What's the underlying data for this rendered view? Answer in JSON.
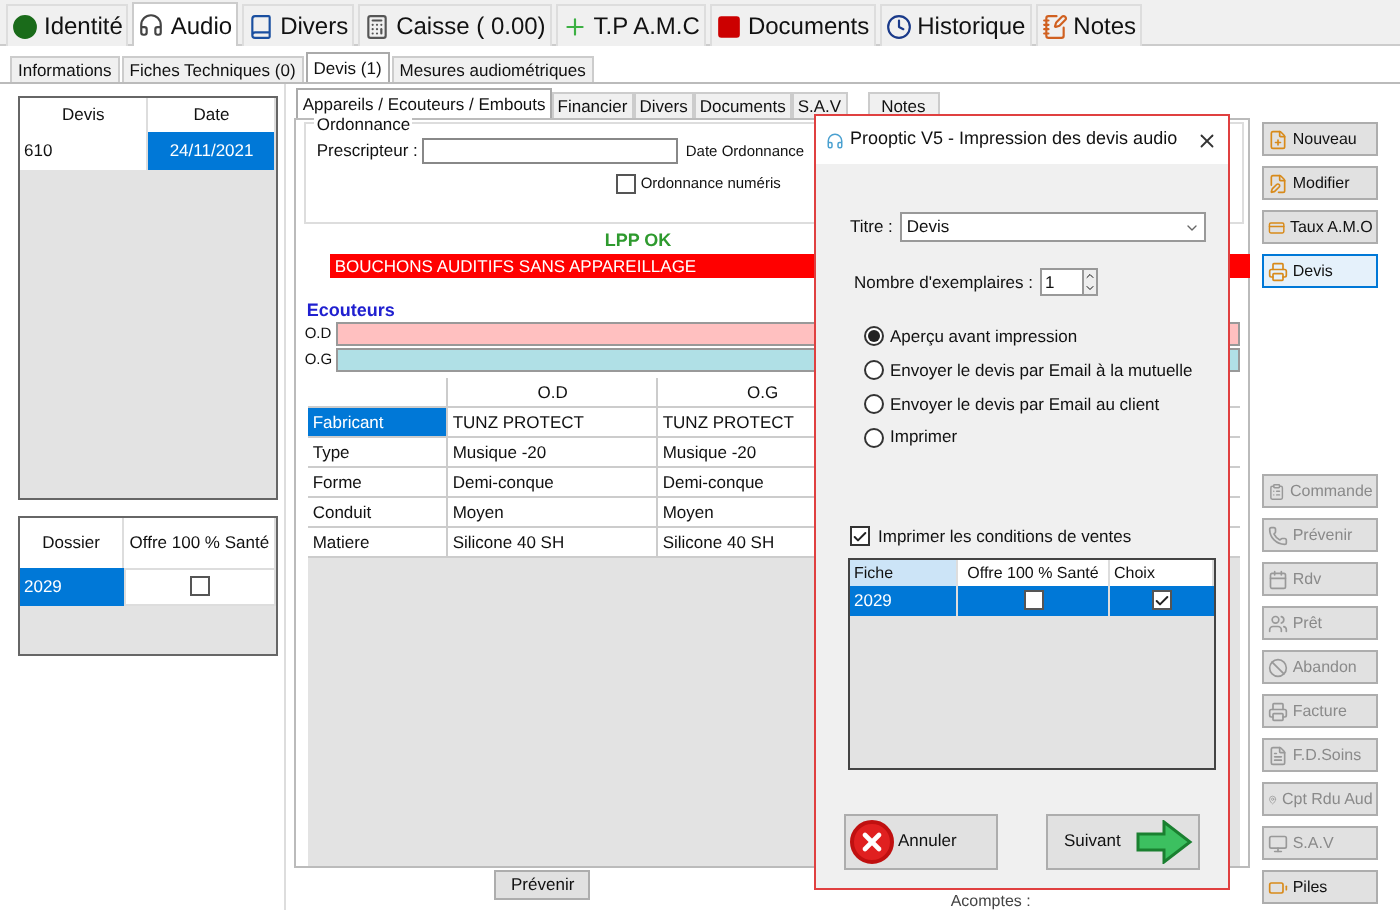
{
  "main_tabs": [
    {
      "label": "Identité",
      "selected": false
    },
    {
      "label": "Audio",
      "selected": true
    },
    {
      "label": "Divers",
      "selected": false
    },
    {
      "label": "Caisse ( 0.00)",
      "selected": false
    },
    {
      "label": "T.P A.M.C",
      "selected": false
    },
    {
      "label": "Documents",
      "selected": false
    },
    {
      "label": "Historique",
      "selected": false
    },
    {
      "label": "Notes",
      "selected": false
    }
  ],
  "sub_tabs": [
    {
      "label": "Informations",
      "selected": false
    },
    {
      "label": "Fiches Techniques (0)",
      "selected": false
    },
    {
      "label": "Devis (1)",
      "selected": true
    },
    {
      "label": "Mesures audiométriques",
      "selected": false
    }
  ],
  "devis_table": {
    "columns": [
      "Devis",
      "Date"
    ],
    "rows": [
      {
        "cells": [
          {
            "text": "610",
            "selected": false
          },
          {
            "text": "24/11/2021",
            "selected": true
          }
        ]
      }
    ]
  },
  "dossier_table": {
    "columns": [
      "Dossier",
      "Offre 100 % Santé"
    ],
    "rows": [
      {
        "dossier": "2029",
        "selected": true,
        "offre_checked": false
      }
    ]
  },
  "detail_tabs": [
    {
      "label": "Appareils / Ecouteurs / Embouts",
      "selected": true
    },
    {
      "label": "Financier",
      "selected": false
    },
    {
      "label": "Divers",
      "selected": false
    },
    {
      "label": "Documents",
      "selected": false
    },
    {
      "label": "S.A.V",
      "selected": false
    },
    {
      "label": "Notes",
      "selected": false
    }
  ],
  "ordonnance": {
    "title": "Ordonnance",
    "prescripteur_label": "Prescripteur :",
    "date_label": "Date Ordonnance",
    "numerique_label": "Ordonnance numéris",
    "numerique_checked": false
  },
  "lpp_status": "LPP OK",
  "alert": "BOUCHONS AUDITIFS SANS APPAREILLAGE",
  "ecouteurs": {
    "title": "Ecouteurs",
    "bars": [
      {
        "label": "O.D",
        "color": "#ffc0c0"
      },
      {
        "label": "O.G",
        "color": "#b0e0e6"
      }
    ]
  },
  "grid": {
    "columns": [
      "O.D",
      "O.G"
    ],
    "rows": [
      {
        "label": "Fabricant",
        "selected": true,
        "values": [
          "TUNZ PROTECT",
          "TUNZ PROTECT"
        ]
      },
      {
        "label": "Type",
        "selected": false,
        "values": [
          "Musique -20",
          "Musique -20"
        ]
      },
      {
        "label": "Forme",
        "selected": false,
        "values": [
          "Demi-conque",
          "Demi-conque"
        ]
      },
      {
        "label": "Conduit",
        "selected": false,
        "values": [
          "Moyen",
          "Moyen"
        ]
      },
      {
        "label": "Matiere",
        "selected": false,
        "values": [
          "Silicone 40 SH",
          "Silicone 40 SH"
        ]
      }
    ]
  },
  "prevenir_button": "Prévenir",
  "acomptes_label": "Acomptes :",
  "side_buttons": [
    {
      "label": "Nouveau",
      "kind": "new",
      "disabled": false,
      "selected": false
    },
    {
      "label": "Modifier",
      "kind": "edit",
      "disabled": false,
      "selected": false
    },
    {
      "label": "Taux A.M.O",
      "kind": "card",
      "disabled": false,
      "selected": false
    },
    {
      "label": "Devis",
      "kind": "print",
      "disabled": false,
      "selected": true
    },
    {
      "label": "Commande",
      "kind": "order",
      "disabled": true,
      "selected": false
    },
    {
      "label": "Prévenir",
      "kind": "phone",
      "disabled": true,
      "selected": false
    },
    {
      "label": "Rdv",
      "kind": "calendar",
      "disabled": true,
      "selected": false
    },
    {
      "label": "Prêt",
      "kind": "lend",
      "disabled": true,
      "selected": false
    },
    {
      "label": "Abandon",
      "kind": "cancel",
      "disabled": true,
      "selected": false
    },
    {
      "label": "Facture",
      "kind": "print",
      "disabled": true,
      "selected": false
    },
    {
      "label": "F.D.Soins",
      "kind": "sheet",
      "disabled": true,
      "selected": false
    },
    {
      "label": "Cpt Rdu Aud",
      "kind": "pin",
      "disabled": true,
      "selected": false
    },
    {
      "label": "S.A.V",
      "kind": "monitor",
      "disabled": true,
      "selected": false
    },
    {
      "label": "Piles",
      "kind": "battery",
      "disabled": false,
      "selected": false
    }
  ],
  "dialog": {
    "title": "Prooptic V5 - Impression des devis audio",
    "titre_label": "Titre :",
    "titre_value": "Devis",
    "copies_label": "Nombre d'exemplaires :",
    "copies_value": "1",
    "options": [
      {
        "label": "Aperçu avant impression",
        "selected": true
      },
      {
        "label": "Envoyer le devis par Email à la mutuelle",
        "selected": false
      },
      {
        "label": "Envoyer le devis par Email au client",
        "selected": false
      },
      {
        "label": "Imprimer",
        "selected": false
      }
    ],
    "conditions": {
      "label": "Imprimer les conditions de ventes",
      "checked": true
    },
    "grid": {
      "columns": [
        "Fiche",
        "Offre 100 % Santé",
        "Choix"
      ],
      "rows": [
        {
          "fiche": "2029",
          "selected": true,
          "offre_checked": false,
          "choix_checked": true
        }
      ]
    },
    "buttons": [
      {
        "label": "Annuler",
        "kind": "cancel"
      },
      {
        "label": "Suivant",
        "kind": "next"
      }
    ]
  }
}
